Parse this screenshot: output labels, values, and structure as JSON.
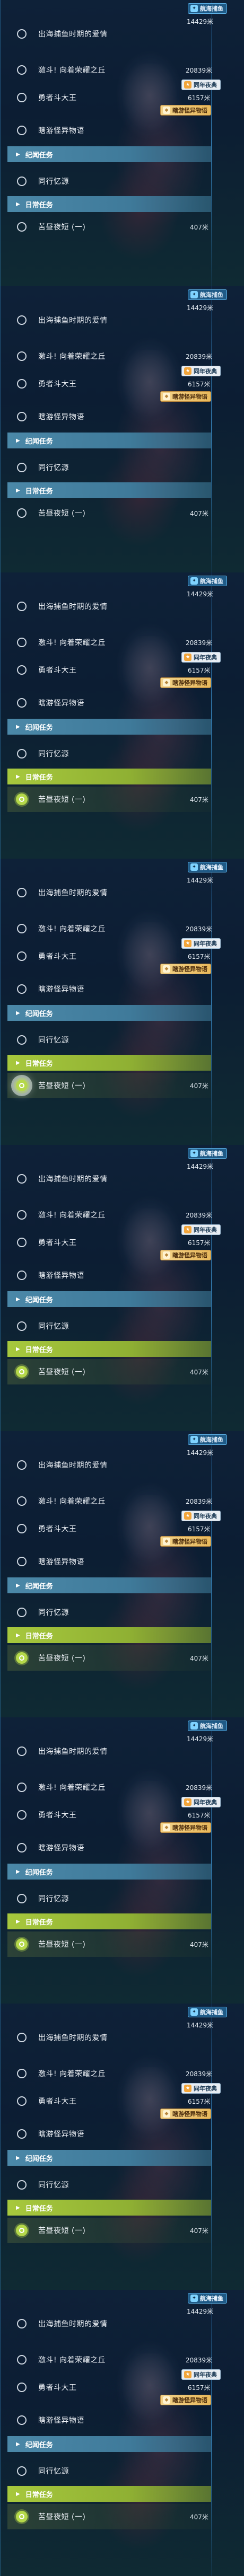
{
  "panels": [
    {
      "selected": null,
      "glow": null
    },
    {
      "selected": null,
      "glow": null
    },
    {
      "selected": "past",
      "glow": null
    },
    {
      "selected": "past",
      "glow": "past"
    },
    {
      "selected": "past",
      "glow": null
    },
    {
      "selected": "past",
      "glow": null
    },
    {
      "selected": "past",
      "glow": null
    },
    {
      "selected": "past",
      "glow": null
    },
    {
      "selected": "past",
      "glow": null
    }
  ],
  "tags": {
    "voyage": "航海捕鱼",
    "tv": "同年夜典",
    "story": "瞎游怪异物语"
  },
  "distances": {
    "top": "14429米",
    "compete": "20839米",
    "king": "6157米",
    "past": "407米"
  },
  "items": {
    "fishing_love": "出海捕鱼时期的爱情",
    "compete": "激斗! 向着荣耀之丘",
    "king": "勇者斗大王",
    "story": "瞎游怪异物语",
    "memory": "同行忆源",
    "past": "苦昼夜短 (一)"
  },
  "headers": {
    "chronicle": "纪闻任务",
    "daily": "日常任务"
  },
  "colors": {
    "header_blue": "#4b88a8",
    "header_green": "#a7c83d",
    "check_green": "#b5d84a"
  }
}
